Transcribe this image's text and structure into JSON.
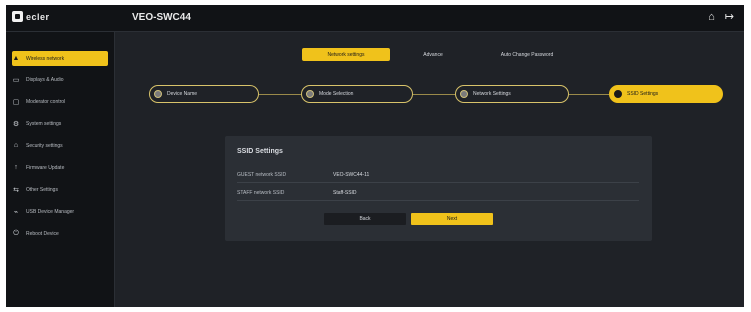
{
  "app": {
    "logo_text": "ecler",
    "device_title": "VEO-SWC44",
    "top_icons": [
      "home-icon",
      "logout-icon"
    ]
  },
  "sidebar": {
    "items": [
      {
        "label": "Wireless network",
        "icon": "warning-icon",
        "active": true
      },
      {
        "label": "Displays & Audio",
        "icon": "display-icon",
        "active": false
      },
      {
        "label": "Moderator control",
        "icon": "moderator-icon",
        "active": false
      },
      {
        "label": "System settings",
        "icon": "gear-icon",
        "active": false
      },
      {
        "label": "Security settings",
        "icon": "lock-icon",
        "active": false
      },
      {
        "label": "Firmware Update",
        "icon": "update-icon",
        "active": false
      },
      {
        "label": "Other Settings",
        "icon": "settings-icon",
        "active": false
      },
      {
        "label": "USB Device Manager",
        "icon": "usb-icon",
        "active": false
      },
      {
        "label": "Reboot Device",
        "icon": "power-icon",
        "active": false
      }
    ]
  },
  "tabs": [
    {
      "label": "Network settings",
      "active": true
    },
    {
      "label": "Advance",
      "active": false
    },
    {
      "label": "Auto Change Password",
      "active": false
    }
  ],
  "steps": [
    {
      "label": "Device Name",
      "active": false
    },
    {
      "label": "Mode Selection",
      "active": false
    },
    {
      "label": "Network Settings",
      "active": false
    },
    {
      "label": "SSID Settings",
      "active": true
    }
  ],
  "panel": {
    "title": "SSID Settings",
    "rows": [
      {
        "label": "GUEST network SSID",
        "value": "VEO-SWC44-11"
      },
      {
        "label": "STAFF network SSID",
        "value": "Staff-SSID"
      }
    ],
    "back_label": "Back",
    "next_label": "Next"
  },
  "colors": {
    "accent": "#f0c21b",
    "background": "#1f2227",
    "sidebar": "#111316",
    "panel": "#2b2f35"
  }
}
